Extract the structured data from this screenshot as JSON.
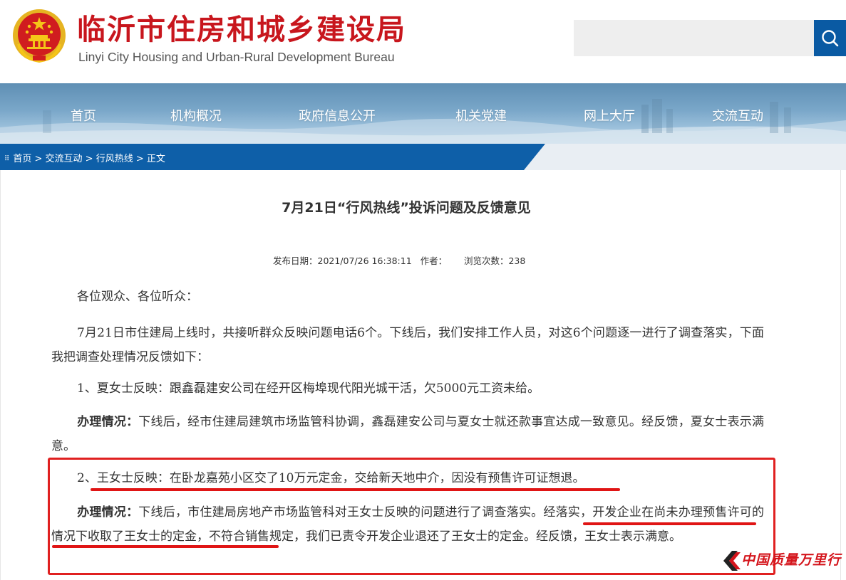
{
  "header": {
    "title": "临沂市住房和城乡建设局",
    "subtitle": "Linyi City Housing and Urban-Rural Development Bureau"
  },
  "search": {
    "placeholder": "",
    "value": ""
  },
  "nav": {
    "items": [
      "首页",
      "机构概况",
      "政府信息公开",
      "机关党建",
      "网上大厅",
      "交流互动"
    ]
  },
  "breadcrumb": {
    "items": [
      "首页",
      "交流互动",
      "行风热线",
      "正文"
    ],
    "separator": " > "
  },
  "article": {
    "title": "7月21日“行风热线”投诉问题及反馈意见",
    "publish_date_label": "发布日期：",
    "publish_date": "2021/07/26 16:38:11",
    "author_label": "作者：",
    "author": "",
    "views_label": "浏览次数：",
    "views": "238",
    "greeting": "各位观众、各位听众：",
    "intro": "7月21日市住建局上线时，共接听群众反映问题电话6个。下线后，我们安排工作人员，对这6个问题逐一进行了调查落实，下面我把调查处理情况反馈如下：",
    "item1": "1、夏女士反映：跟鑫磊建安公司在经开区梅埠现代阳光城干活，欠5000元工资未给。",
    "item1_label": "办理情况：",
    "item1_result": "下线后，经市住建局建筑市场监管科协调，鑫磊建安公司与夏女士就还款事宜达成一致意见。经反馈，夏女士表示满意。",
    "item2": "2、王女士反映：在卧龙嘉苑小区交了10万元定金，交给新天地中介，因没有预售许可证想退。",
    "item2_label": "办理情况：",
    "item2_result": "下线后，市住建局房地产市场监管科对王女士反映的问题进行了调查落实。经落实，开发企业在尚未办理预售许可的情况下收取了王女士的定金，不符合销售规定，我们已责令开发企业退还了王女士的定金。经反馈，王女士表示满意。"
  },
  "watermark": "中国质量万里行",
  "colors": {
    "brand_red": "#c8161d",
    "nav_blue": "#0a5aa3",
    "annotation_red": "#e02020"
  }
}
